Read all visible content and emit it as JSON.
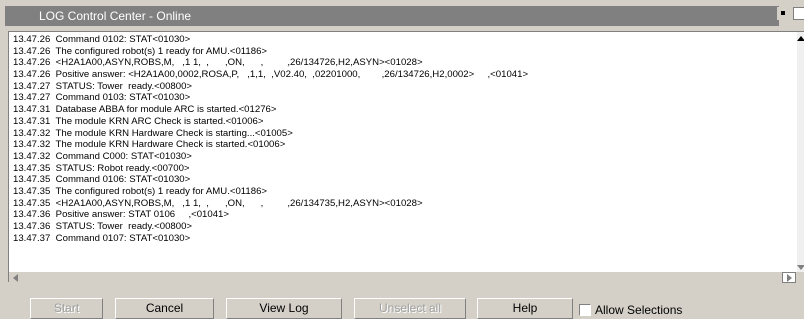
{
  "window": {
    "title": "LOG Control Center - Online"
  },
  "log": {
    "lines": [
      "13.47.26  Command 0102: STAT<01030>",
      "13.47.26  The configured robot(s) 1 ready for AMU.<01186>",
      "13.47.26  <H2A1A00,ASYN,ROBS,M,   ,1 1,  ,      ,ON,      ,         ,26/134726,H2,ASYN><01028>",
      "13.47.26  Positive answer: <H2A1A00,0002,ROSA,P,   ,1,1,  ,V02.40,  ,02201000,        ,26/134726,H2,0002>     ,<01041>",
      "13.47.27  STATUS: Tower  ready.<00800>",
      "13.47.27  Command 0103: STAT<01030>",
      "13.47.31  Database ABBA for module ARC is started.<01276>",
      "13.47.31  The module KRN ARC Check is started.<01006>",
      "13.47.32  The module KRN Hardware Check is starting...<01005>",
      "13.47.32  The module KRN Hardware Check is started.<01006>",
      "13.47.32  Command C000: STAT<01030>",
      "13.47.35  STATUS: Robot ready.<00700>",
      "13.47.35  Command 0106: STAT<01030>",
      "13.47.35  The configured robot(s) 1 ready for AMU.<01186>",
      "13.47.35  <H2A1A00,ASYN,ROBS,M,   ,1 1,  ,      ,ON,      ,         ,26/134735,H2,ASYN><01028>",
      "13.47.36  Positive answer: STAT 0106     ,<01041>",
      "13.47.36  STATUS: Tower  ready.<00800>",
      "13.47.37  Command 0107: STAT<01030>"
    ]
  },
  "buttons": {
    "start": "Start",
    "cancel": "Cancel",
    "view_log": "View Log",
    "unselect_all": "Unselect all",
    "help": "Help"
  },
  "allow_selections": {
    "label": "Allow Selections",
    "checked": false
  },
  "colors": {
    "window_bg": "#d4d0c8",
    "title_strip": "#808080",
    "log_bg": "#ffffff"
  }
}
